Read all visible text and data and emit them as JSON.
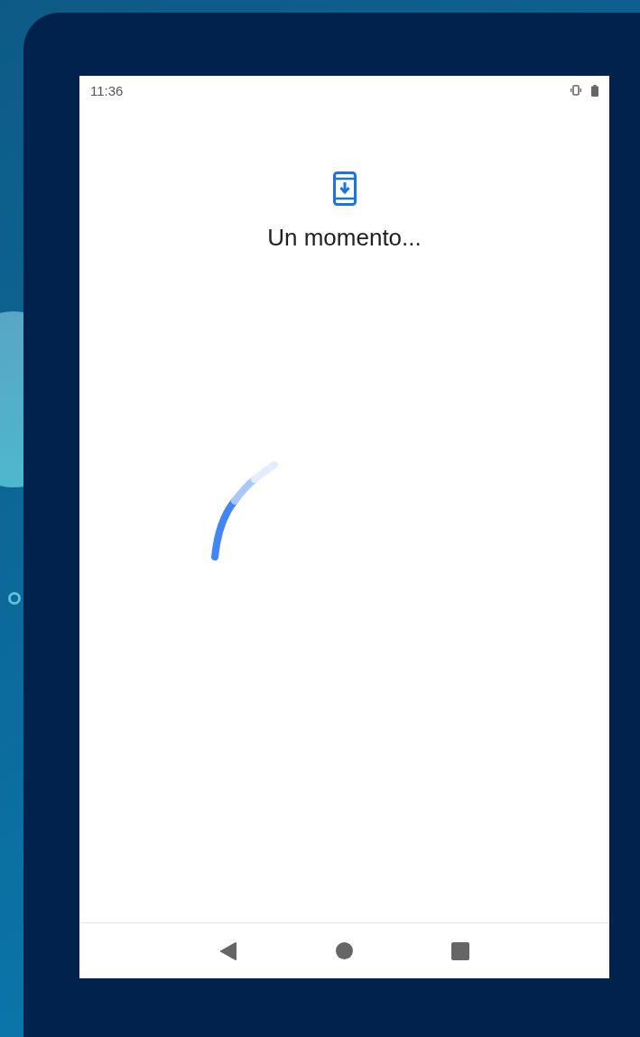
{
  "status_bar": {
    "time": "11:36"
  },
  "title": "Un momento..."
}
